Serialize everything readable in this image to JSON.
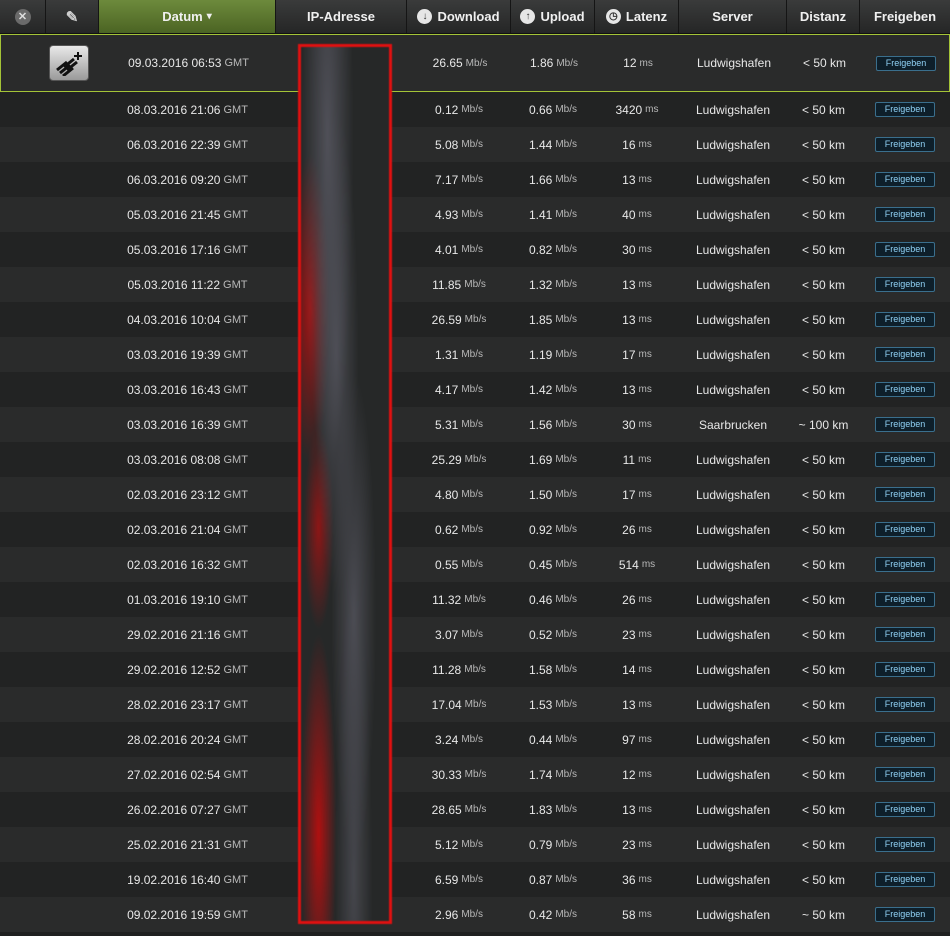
{
  "header": {
    "datum_label": "Datum",
    "datum_sort_arrow": "▾",
    "ip_label": "IP-Adresse",
    "download_label": "Download",
    "upload_label": "Upload",
    "latenz_label": "Latenz",
    "server_label": "Server",
    "distanz_label": "Distanz",
    "freigeben_label": "Freigeben",
    "close_glyph": "✕",
    "edit_glyph": "✎",
    "download_glyph": "↓",
    "upload_glyph": "↑",
    "latenz_glyph": "◷",
    "active_color": "#5b7a2c"
  },
  "units": {
    "speed": "Mb/s",
    "latency": "ms",
    "tz": "GMT"
  },
  "share_label": "Freigeben",
  "rows": [
    {
      "date": "09.03.2016 06:53",
      "download": "26.65",
      "upload": "1.86",
      "latency": "12",
      "server": "Ludwigshafen",
      "distance": "< 50 km",
      "selected": true
    },
    {
      "date": "08.03.2016 21:06",
      "download": "0.12",
      "upload": "0.66",
      "latency": "3420",
      "server": "Ludwigshafen",
      "distance": "< 50 km"
    },
    {
      "date": "06.03.2016 22:39",
      "download": "5.08",
      "upload": "1.44",
      "latency": "16",
      "server": "Ludwigshafen",
      "distance": "< 50 km"
    },
    {
      "date": "06.03.2016 09:20",
      "download": "7.17",
      "upload": "1.66",
      "latency": "13",
      "server": "Ludwigshafen",
      "distance": "< 50 km"
    },
    {
      "date": "05.03.2016 21:45",
      "download": "4.93",
      "upload": "1.41",
      "latency": "40",
      "server": "Ludwigshafen",
      "distance": "< 50 km"
    },
    {
      "date": "05.03.2016 17:16",
      "download": "4.01",
      "upload": "0.82",
      "latency": "30",
      "server": "Ludwigshafen",
      "distance": "< 50 km"
    },
    {
      "date": "05.03.2016 11:22",
      "download": "11.85",
      "upload": "1.32",
      "latency": "13",
      "server": "Ludwigshafen",
      "distance": "< 50 km"
    },
    {
      "date": "04.03.2016 10:04",
      "download": "26.59",
      "upload": "1.85",
      "latency": "13",
      "server": "Ludwigshafen",
      "distance": "< 50 km"
    },
    {
      "date": "03.03.2016 19:39",
      "download": "1.31",
      "upload": "1.19",
      "latency": "17",
      "server": "Ludwigshafen",
      "distance": "< 50 km"
    },
    {
      "date": "03.03.2016 16:43",
      "download": "4.17",
      "upload": "1.42",
      "latency": "13",
      "server": "Ludwigshafen",
      "distance": "< 50 km"
    },
    {
      "date": "03.03.2016 16:39",
      "download": "5.31",
      "upload": "1.56",
      "latency": "30",
      "server": "Saarbrucken",
      "distance": "~ 100 km"
    },
    {
      "date": "03.03.2016 08:08",
      "download": "25.29",
      "upload": "1.69",
      "latency": "11",
      "server": "Ludwigshafen",
      "distance": "< 50 km"
    },
    {
      "date": "02.03.2016 23:12",
      "download": "4.80",
      "upload": "1.50",
      "latency": "17",
      "server": "Ludwigshafen",
      "distance": "< 50 km"
    },
    {
      "date": "02.03.2016 21:04",
      "download": "0.62",
      "upload": "0.92",
      "latency": "26",
      "server": "Ludwigshafen",
      "distance": "< 50 km"
    },
    {
      "date": "02.03.2016 16:32",
      "download": "0.55",
      "upload": "0.45",
      "latency": "514",
      "server": "Ludwigshafen",
      "distance": "< 50 km"
    },
    {
      "date": "01.03.2016 19:10",
      "download": "11.32",
      "upload": "0.46",
      "latency": "26",
      "server": "Ludwigshafen",
      "distance": "< 50 km"
    },
    {
      "date": "29.02.2016 21:16",
      "download": "3.07",
      "upload": "0.52",
      "latency": "23",
      "server": "Ludwigshafen",
      "distance": "< 50 km"
    },
    {
      "date": "29.02.2016 12:52",
      "download": "11.28",
      "upload": "1.58",
      "latency": "14",
      "server": "Ludwigshafen",
      "distance": "< 50 km"
    },
    {
      "date": "28.02.2016 23:17",
      "download": "17.04",
      "upload": "1.53",
      "latency": "13",
      "server": "Ludwigshafen",
      "distance": "< 50 km"
    },
    {
      "date": "28.02.2016 20:24",
      "download": "3.24",
      "upload": "0.44",
      "latency": "97",
      "server": "Ludwigshafen",
      "distance": "< 50 km"
    },
    {
      "date": "27.02.2016 02:54",
      "download": "30.33",
      "upload": "1.74",
      "latency": "12",
      "server": "Ludwigshafen",
      "distance": "< 50 km"
    },
    {
      "date": "26.02.2016 07:27",
      "download": "28.65",
      "upload": "1.83",
      "latency": "13",
      "server": "Ludwigshafen",
      "distance": "< 50 km"
    },
    {
      "date": "25.02.2016 21:31",
      "download": "5.12",
      "upload": "0.79",
      "latency": "23",
      "server": "Ludwigshafen",
      "distance": "< 50 km"
    },
    {
      "date": "19.02.2016 16:40",
      "download": "6.59",
      "upload": "0.87",
      "latency": "36",
      "server": "Ludwigshafen",
      "distance": "< 50 km"
    },
    {
      "date": "09.02.2016 19:59",
      "download": "2.96",
      "upload": "0.42",
      "latency": "58",
      "server": "Ludwigshafen",
      "distance": "~ 50 km"
    }
  ]
}
